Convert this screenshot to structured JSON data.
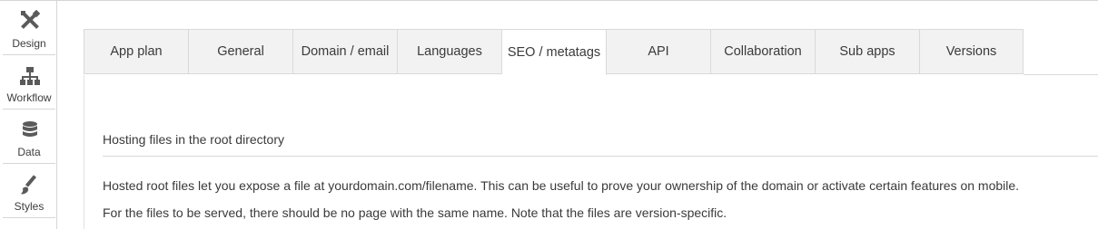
{
  "sidebar": {
    "items": [
      {
        "label": "Design",
        "icon": "design-tools-icon"
      },
      {
        "label": "Workflow",
        "icon": "workflow-icon"
      },
      {
        "label": "Data",
        "icon": "database-icon"
      },
      {
        "label": "Styles",
        "icon": "paintbrush-icon"
      }
    ]
  },
  "tabs": [
    {
      "label": "App plan"
    },
    {
      "label": "General"
    },
    {
      "label": "Domain / email"
    },
    {
      "label": "Languages"
    },
    {
      "label": "SEO / metatags",
      "active": true
    },
    {
      "label": "API"
    },
    {
      "label": "Collaboration"
    },
    {
      "label": "Sub apps"
    },
    {
      "label": "Versions"
    }
  ],
  "section": {
    "title": "Hosting files in the root directory",
    "line1": "Hosted root files let you expose a file at yourdomain.com/filename. This can be useful to prove your ownership of the domain or activate certain features on mobile.",
    "line2": "For the files to be served, there should be no page with the same name. Note that the files are version-specific."
  },
  "colors": {
    "border": "#d6d6d6",
    "tab_bg": "#f2f2f2",
    "icon": "#5a5a5a"
  }
}
